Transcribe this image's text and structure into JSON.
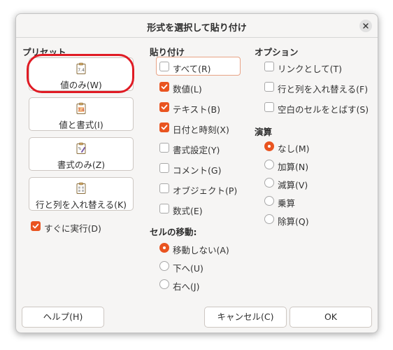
{
  "dialog": {
    "title": "形式を選択して貼り付け",
    "close_icon": "close-icon"
  },
  "presets": {
    "header": "プリセット",
    "buttons": [
      {
        "label": "値のみ(W)",
        "icon": "values-only-icon"
      },
      {
        "label": "値と書式(I)",
        "icon": "values-formats-icon"
      },
      {
        "label": "書式のみ(Z)",
        "icon": "formats-only-icon"
      },
      {
        "label": "行と列を入れ替える(K)",
        "icon": "transpose-icon"
      }
    ],
    "run_immediately": {
      "label": "すぐに実行(D)",
      "checked": true
    }
  },
  "paste": {
    "header": "貼り付け",
    "items": [
      {
        "label": "すべて(R)",
        "checked": false
      },
      {
        "label": "数値(L)",
        "checked": true
      },
      {
        "label": "テキスト(B)",
        "checked": true
      },
      {
        "label": "日付と時刻(X)",
        "checked": true
      },
      {
        "label": "書式設定(Y)",
        "checked": false
      },
      {
        "label": "コメント(G)",
        "checked": false
      },
      {
        "label": "オブジェクト(P)",
        "checked": false
      },
      {
        "label": "数式(E)",
        "checked": false
      }
    ]
  },
  "move_cells": {
    "header": "セルの移動:",
    "items": [
      {
        "label": "移動しない(A)",
        "selected": true
      },
      {
        "label": "下へ(U)",
        "selected": false
      },
      {
        "label": "右へ(J)",
        "selected": false
      }
    ]
  },
  "options": {
    "header": "オプション",
    "items": [
      {
        "label": "リンクとして(T)",
        "checked": false
      },
      {
        "label": "行と列を入れ替える(F)",
        "checked": false
      },
      {
        "label": "空白のセルをとばす(S)",
        "checked": false
      }
    ]
  },
  "operations": {
    "header": "演算",
    "items": [
      {
        "label": "なし(M)",
        "selected": true
      },
      {
        "label": "加算(N)",
        "selected": false
      },
      {
        "label": "減算(V)",
        "selected": false
      },
      {
        "label": "乗算",
        "selected": false
      },
      {
        "label": "除算(Q)",
        "selected": false
      }
    ]
  },
  "buttons": {
    "help": "ヘルプ(H)",
    "cancel": "キャンセル(C)",
    "ok": "OK"
  },
  "colors": {
    "accent": "#e95420",
    "highlight_ring": "#e01b24"
  }
}
